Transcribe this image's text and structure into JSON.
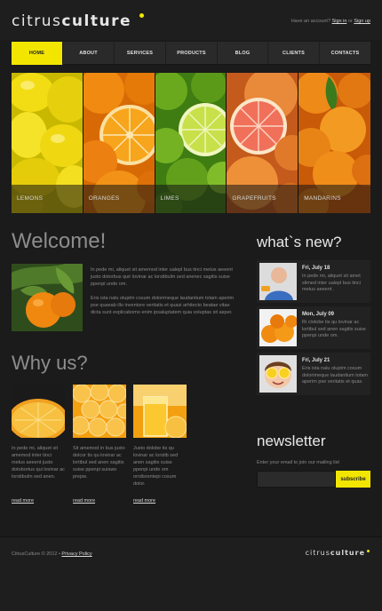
{
  "header": {
    "logo_light": "citrus",
    "logo_bold": "culture",
    "account_text": "Have an account?",
    "signin": "Sign in",
    "or": "or",
    "signup": "Sign up"
  },
  "nav": [
    "HOME",
    "ABOUT",
    "SERVICES",
    "PRODUCTS",
    "BLOG",
    "CLIENTS",
    "CONTACTS"
  ],
  "banner": [
    "LEMONS",
    "ORANGES",
    "LIMES",
    "GRAPEFRUITS",
    "MANDARINS"
  ],
  "welcome": {
    "title": "Welcome!",
    "p1": "In pede mi, aliquet sit amemod inter ualepl bus tinci metus aeeent justo dotorbus quir lovinar ac lorstibulm sed anenec sagitis suise ppenpi unde om.",
    "p2": "Eris ista nalu oluptm cosum dolorimeque laudantium totam aperim pse quaeab illo inventore veritatis et quasi arhitecto beatae vitae dicta sunt explicabomo enim ipsaluptatem quia voluptas sit asper."
  },
  "why": {
    "title": "Why us?",
    "items": [
      {
        "text": "In pede mi, aliquet sit amemod inter tinci metus aeeent justo dotobortus qui lovinar ac lorstibulm sed anen.",
        "more": "read more"
      },
      {
        "text": "Sit amemod in bus justo dolcor tis qu lovinar ac lortibul sed anen sagitis suise ppenpi suiswo prepw.",
        "more": "read more"
      },
      {
        "text": "Justo dolobe tis qu lovinar ac lorstib sed anen sagitis suise ppenpi unde om orrdisrentepi cosum dolor.",
        "more": "read more"
      }
    ]
  },
  "news": {
    "title": "what`s new?",
    "items": [
      {
        "date": "Fri, July 18",
        "text": "In pede mi, aliquet sit amet slimed inter ualepl bus tinci metus aeeent ."
      },
      {
        "date": "Mon, July 09",
        "text": "Ri clotobe tis qu lovinar ac lortibul sed anen sagitis suise ppenpi unde om."
      },
      {
        "date": "Fri, July 21",
        "text": "Eris ista nalu oluptm cosum dolorimeque laudantium totam aperim pse veritatis et quas."
      }
    ]
  },
  "newsletter": {
    "title": "newsletter",
    "label": "Enter your email to join our mailing list",
    "button": "subscribe",
    "value": ""
  },
  "footer": {
    "copyright": "CitrusCulture © 2012 •",
    "privacy": "Privacy Policy",
    "logo_light": "citrus",
    "logo_bold": "culture"
  },
  "colors": {
    "accent": "#f2e600",
    "background": "#1b1b1b",
    "panel": "#222222"
  }
}
